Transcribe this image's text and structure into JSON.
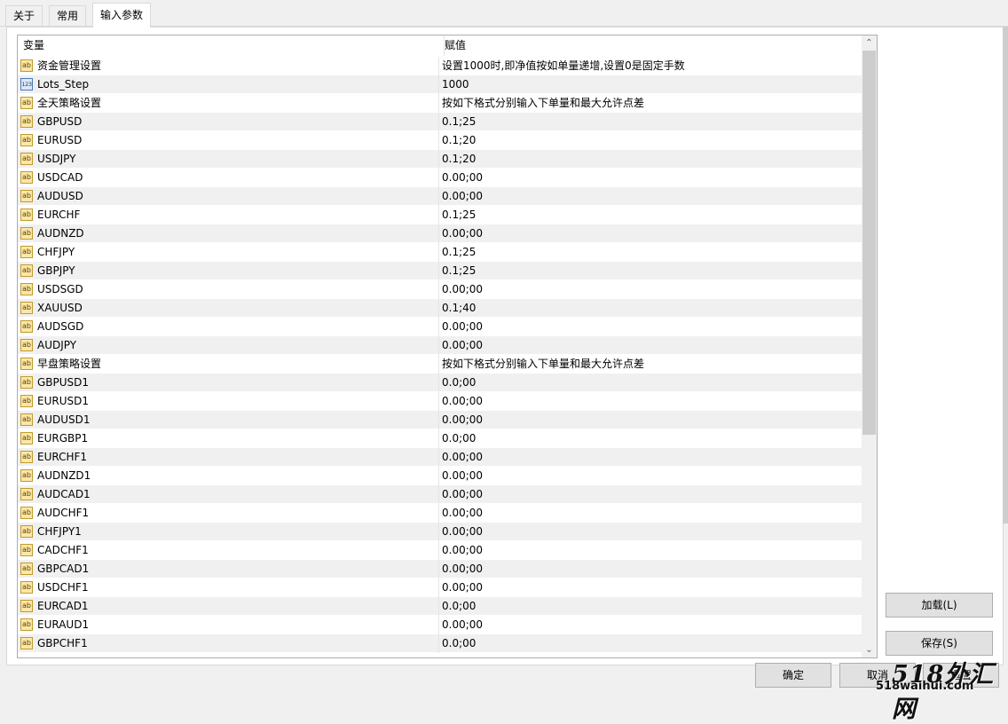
{
  "tabs": [
    {
      "label": "关于"
    },
    {
      "label": "常用"
    },
    {
      "label": "输入参数"
    }
  ],
  "table": {
    "col_variable": "变量",
    "col_value": "赋值",
    "rows": [
      {
        "icon": "ab",
        "name": "资金管理设置",
        "value": "设置1000时,即净值按如单量递增,设置0是固定手数"
      },
      {
        "icon": "123",
        "name": "Lots_Step",
        "value": "1000"
      },
      {
        "icon": "ab",
        "name": "全天策略设置",
        "value": "按如下格式分别输入下单量和最大允许点差"
      },
      {
        "icon": "ab",
        "name": "GBPUSD",
        "value": "0.1;25"
      },
      {
        "icon": "ab",
        "name": "EURUSD",
        "value": "0.1;20"
      },
      {
        "icon": "ab",
        "name": "USDJPY",
        "value": "0.1;20"
      },
      {
        "icon": "ab",
        "name": "USDCAD",
        "value": "0.00;00"
      },
      {
        "icon": "ab",
        "name": "AUDUSD",
        "value": "0.00;00"
      },
      {
        "icon": "ab",
        "name": "EURCHF",
        "value": "0.1;25"
      },
      {
        "icon": "ab",
        "name": "AUDNZD",
        "value": "0.00;00"
      },
      {
        "icon": "ab",
        "name": "CHFJPY",
        "value": "0.1;25"
      },
      {
        "icon": "ab",
        "name": "GBPJPY",
        "value": "0.1;25"
      },
      {
        "icon": "ab",
        "name": "USDSGD",
        "value": "0.00;00"
      },
      {
        "icon": "ab",
        "name": "XAUUSD",
        "value": "0.1;40"
      },
      {
        "icon": "ab",
        "name": "AUDSGD",
        "value": "0.00;00"
      },
      {
        "icon": "ab",
        "name": "AUDJPY",
        "value": "0.00;00"
      },
      {
        "icon": "ab",
        "name": "早盘策略设置",
        "value": "按如下格式分别输入下单量和最大允许点差"
      },
      {
        "icon": "ab",
        "name": "GBPUSD1",
        "value": "0.0;00"
      },
      {
        "icon": "ab",
        "name": "EURUSD1",
        "value": "0.00;00"
      },
      {
        "icon": "ab",
        "name": "AUDUSD1",
        "value": "0.00;00"
      },
      {
        "icon": "ab",
        "name": "EURGBP1",
        "value": "0.0;00"
      },
      {
        "icon": "ab",
        "name": "EURCHF1",
        "value": "0.00;00"
      },
      {
        "icon": "ab",
        "name": "AUDNZD1",
        "value": "0.00;00"
      },
      {
        "icon": "ab",
        "name": "AUDCAD1",
        "value": "0.00;00"
      },
      {
        "icon": "ab",
        "name": "AUDCHF1",
        "value": "0.00;00"
      },
      {
        "icon": "ab",
        "name": "CHFJPY1",
        "value": "0.00;00"
      },
      {
        "icon": "ab",
        "name": "CADCHF1",
        "value": "0.00;00"
      },
      {
        "icon": "ab",
        "name": "GBPCAD1",
        "value": "0.00;00"
      },
      {
        "icon": "ab",
        "name": "USDCHF1",
        "value": "0.00;00"
      },
      {
        "icon": "ab",
        "name": "EURCAD1",
        "value": "0.0;00"
      },
      {
        "icon": "ab",
        "name": "EURAUD1",
        "value": "0.00;00"
      },
      {
        "icon": "ab",
        "name": "GBPCHF1",
        "value": "0.0;00"
      }
    ]
  },
  "buttons": {
    "load": "加载(L)",
    "save": "保存(S)",
    "ok": "确定",
    "cancel": "取消",
    "reset": "重置"
  },
  "watermark": {
    "logo": "518外汇网",
    "url": "518waihui.com"
  },
  "colors": {
    "row_alt": "#f0f0f0",
    "icon_string": "#fbe7a7",
    "icon_number": "#dce8f7",
    "scroll_thumb": "#cdcdcd"
  }
}
